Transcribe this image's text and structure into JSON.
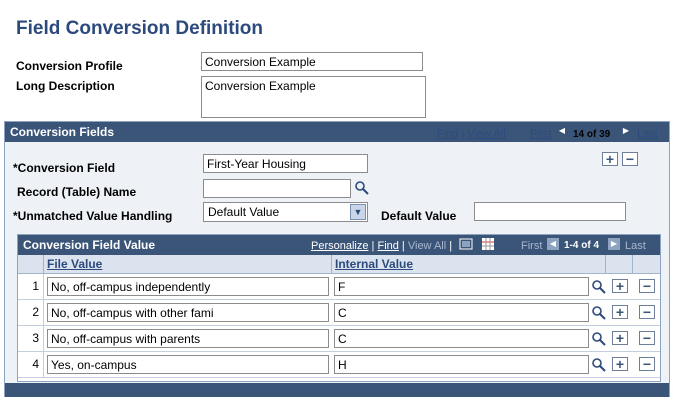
{
  "page": {
    "title": "Field Conversion Definition"
  },
  "profile": {
    "label": "Conversion Profile",
    "value": "Conversion Example"
  },
  "long_description": {
    "label": "Long Description",
    "value": "Conversion Example"
  },
  "conversion_fields": {
    "title": "Conversion Fields",
    "find": "Find",
    "view_all": "View All",
    "first": "First",
    "position": "14 of 39",
    "last": "Last",
    "add_icon": "plus-icon",
    "delete_icon": "minus-icon"
  },
  "form": {
    "conversion_field_label": "*Conversion Field",
    "conversion_field_value": "First-Year Housing",
    "record_name_label": "Record (Table) Name",
    "record_name_value": "",
    "unmatched_label": "*Unmatched Value Handling",
    "unmatched_value": "Default Value",
    "default_value_label": "Default Value",
    "default_value_value": ""
  },
  "value_grid": {
    "title": "Conversion Field Value",
    "personalize": "Personalize",
    "find": "Find",
    "view_all": "View All",
    "first": "First",
    "position": "1-4 of 4",
    "last": "Last",
    "col_file_value": "File Value",
    "col_internal_value": "Internal Value",
    "rows": [
      {
        "num": "1",
        "file_value": "No, off-campus independently",
        "internal_value": "F"
      },
      {
        "num": "2",
        "file_value": "No, off-campus with other fami",
        "internal_value": "C"
      },
      {
        "num": "3",
        "file_value": "No, off-campus with parents",
        "internal_value": "C"
      },
      {
        "num": "4",
        "file_value": "Yes, on-campus",
        "internal_value": "H"
      }
    ]
  },
  "icons": {
    "lookup": "magnifier-icon",
    "download": "download-icon",
    "grid_view": "grid-icon"
  }
}
